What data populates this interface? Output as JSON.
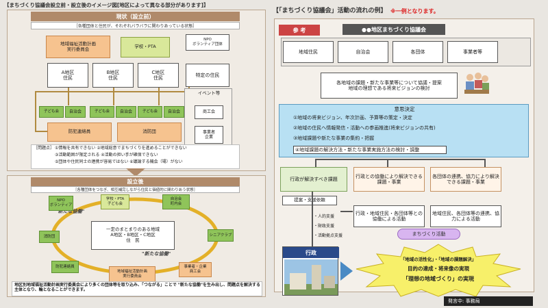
{
  "left": {
    "title": "【まちづくり協議会設立前・設立後のイメージ図[地区によって異なる部分があります]】",
    "current": {
      "header": "現状（設立前）",
      "subtitle": "［各種団体と住民が、それぞれバラバラに関わりあっている状態］",
      "top_boxes": [
        "地域福祉活動計画\n実行委員会",
        "学校・PTA",
        "NPO\nボランティア団体"
      ],
      "areas": [
        "A地区\n住民",
        "B地区\n住民",
        "C地区\n住民"
      ],
      "special": "特定の住民",
      "groups": [
        "子ども会",
        "自治会",
        "子ども会",
        "自治会",
        "子ども会",
        "自治会"
      ],
      "bottom_boxes": [
        "防犯連絡員",
        "消防団"
      ],
      "event_title": "イベント等",
      "event_items": [
        "商工会",
        "事業者\n企業"
      ],
      "issues_title": "［問題点］",
      "issues": [
        "①情報を共有できない ②地域総意でまちづくりを進めることができない",
        "③活動範囲が限定される ④活動の担い手が確保できない",
        "⑤団体や住民同士の連携が容易ではない ⑥議論する機会（場）がない"
      ]
    },
    "after": {
      "header": "設立後",
      "subtitle": "［各種団体をつなぎ、相互補完しながら住民と価値的に関わりあう状態］",
      "nodes": [
        "NPO\nボランティア",
        "学校・PTA\n子ども会",
        "自治会\n町内会",
        "シニアクラブ",
        "事業者・企業\n商工会",
        "地域福祉活動計画\n実行委員会",
        "防犯連絡員",
        "消防団"
      ],
      "center": "一定のまとまりのある地域\nA地区・B地区・C地区\n住　民",
      "arc_labels": [
        "\"新たな協働\"",
        "\"新たな協働\""
      ],
      "footer": "地区別地域福祉活動計画実行委員会により多くの団体等を取り込み、「つながる」ことで \"新たな協働\"を生み出し、問題点を解決する主体となり、輪となることができます。"
    }
  },
  "right": {
    "title": "【「まちづくり協議会」活動の流れの例】",
    "note": "※一例となります。",
    "ref_badge": "参 考",
    "council": "●●地区まちづくり協議会",
    "members": [
      "地域住民",
      "自治会",
      "各団体",
      "事業者等"
    ],
    "discussion": "各地域の課題・新たな事業等について協議・提案\n地域の理想である将来ビジョンの検討",
    "decision_title": "意思決定",
    "decisions": [
      "①地域の将来ビジョン、年次計画、予算等の策定・決定",
      "②地域の住民へ情報発信・活動への参画推進(将来ビジョンの共有)",
      "③地域課題や新たな事業の集約・把握",
      "④地域課題の解決方法・新たな事業実施方法の検討・調整"
    ],
    "task_boxes": [
      "行政が解決すべき課題",
      "行政との協働により解決できる課題・事業",
      "各団体の連携、協力により解決できる課題・事業"
    ],
    "request": "提案・支援依頼",
    "collab1": "行政・地域住民・各団体等との協働による活動",
    "collab2": "地域住民、各団体等の連携、協力による活動",
    "supports": [
      "・人的支援",
      "・財政支援",
      "・活動拠点支援"
    ],
    "admin": "行政",
    "activity_badge": "まちづくり活動",
    "goal_lines": [
      "「地域の活性化」・「地域の課題解決」",
      "目的の達成・将来像の実現",
      "「理想の地域づくり」の実現"
    ]
  },
  "status": "発言中: 事務局",
  "colors": {
    "accent_red": "#d22222",
    "header_brown": "#b08a6a",
    "lblue": "#b8e0f3",
    "goal_yellow": "#f7f06a"
  }
}
